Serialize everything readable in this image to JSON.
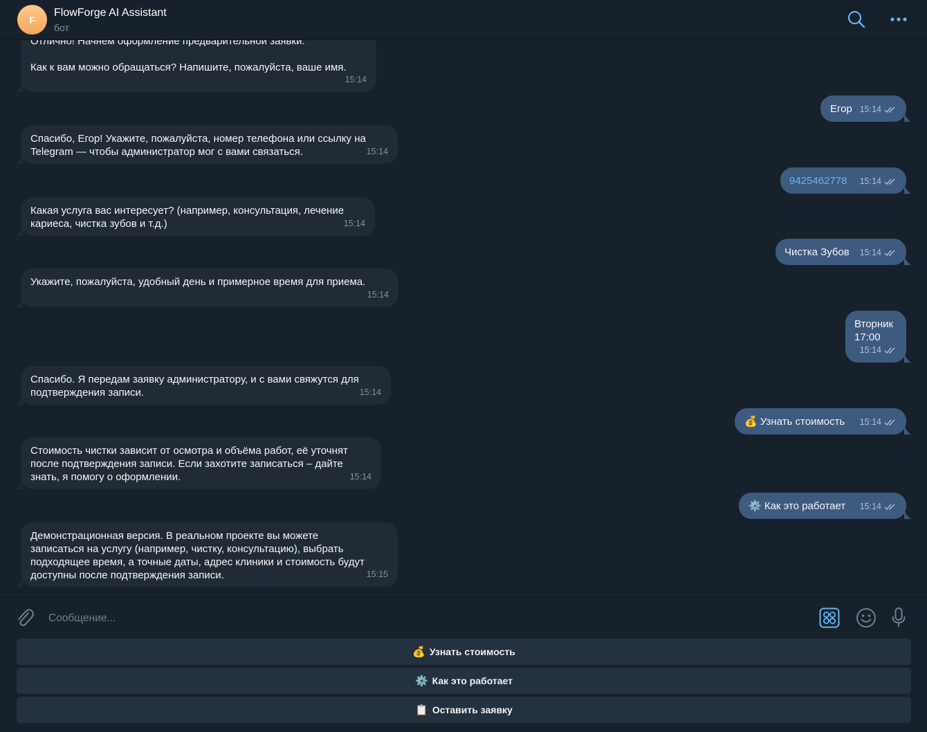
{
  "header": {
    "avatar_letter": "F",
    "title": "FlowForge AI Assistant",
    "subtitle": "бот"
  },
  "messages": [
    {
      "text": "Отлично! Начнем оформление предварительной заявки.\n\nКак к вам можно обращаться? Напишите, пожалуйста, ваше имя.",
      "time": "15:14"
    },
    {
      "text": "Егор",
      "time": "15:14"
    },
    {
      "text": "Спасибо, Егор! Укажите, пожалуйста, номер телефона или ссылку на\nTelegram — чтобы администратор мог с вами связаться.",
      "time": "15:14"
    },
    {
      "text": "9425462778",
      "time": "15:14"
    },
    {
      "text": "Какая услуга вас интересует? (например, консультация, лечение\nкариеса, чистка зубов и т.д.)",
      "time": "15:14"
    },
    {
      "text": "Чистка Зубов",
      "time": "15:14"
    },
    {
      "text": "Укажите, пожалуйста, удобный день и примерное время для приема.",
      "time": "15:14"
    },
    {
      "text": "Вторник\n17:00",
      "time": "15:14"
    },
    {
      "text": "Спасибо. Я передам заявку администратору, и с вами свяжутся для\nподтверждения записи.",
      "time": "15:14"
    },
    {
      "text": "💰 Узнать стоимость",
      "time": "15:14"
    },
    {
      "text": "Стоимость чистки зависит от осмотра и объёма работ, её уточнят\nпосле подтверждения записи. Если захотите записаться – дайте\nзнать, я помогу о оформлении.",
      "time": "15:14"
    },
    {
      "text": "⚙️ Как это работает",
      "time": "15:14"
    },
    {
      "text": "Демонстрационная версия. В реальном проекте вы можете\nзаписаться на услугу (например, чистку, консультацию), выбрать\nподходящее время, а точные даты, адрес клиники и стоимость будут\nдоступны после подтверждения записи.",
      "time": "15:15"
    }
  ],
  "composer": {
    "placeholder": "Сообщение..."
  },
  "keyboard": [
    {
      "emoji": "💰",
      "label": "Узнать стоимость"
    },
    {
      "emoji": "⚙️",
      "label": "Как это работает"
    },
    {
      "emoji": "📋",
      "label": "Оставить заявку"
    }
  ],
  "colors": {
    "background": "#17212b",
    "incoming_bubble": "#202b36",
    "outgoing_bubble": "#3e5a7f",
    "accent": "#5eb5f7",
    "phone_link": "#6ab3f3"
  }
}
